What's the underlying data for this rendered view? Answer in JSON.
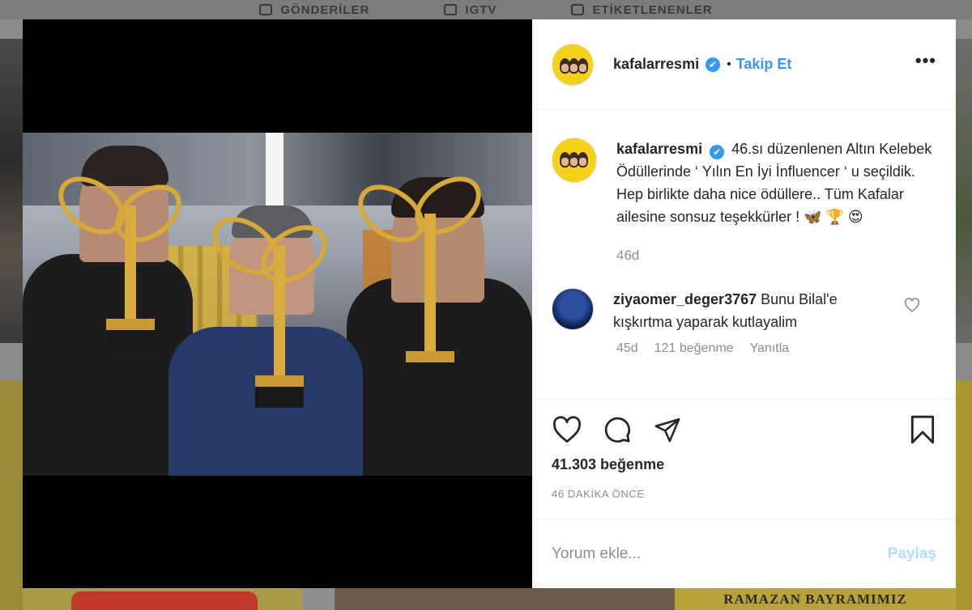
{
  "background": {
    "tabs": [
      {
        "label": "GÖNDERİLER",
        "icon": "grid-icon"
      },
      {
        "label": "IGTV",
        "icon": "igtv-icon"
      },
      {
        "label": "ETİKETLENENLER",
        "icon": "tagged-icon"
      }
    ],
    "bottom_banner": "RAMAZAN BAYRAMIMIZ"
  },
  "post": {
    "header": {
      "username": "kafalarresmi",
      "verified": "✔",
      "separator": "•",
      "follow_label": "Takip Et",
      "more_label": "•••"
    },
    "caption": {
      "username": "kafalarresmi",
      "text": "46.sı düzenlenen Altın Kelebek Ödüllerinde ‘ Yılın En İyi İnfluencer ‘ u seçildik. Hep birlikte daha nice ödüllere.. Tüm Kafalar ailesine sonsuz teşekkürler ! 🦋 🏆 😍",
      "time": "46d"
    },
    "comments": [
      {
        "username": "ziyaomer_deger3767",
        "text": "Bunu Bilal'e kışkırtma yaparak kutlayalim",
        "time": "45d",
        "likes": "121 beğenme",
        "reply_label": "Yanıtla"
      }
    ],
    "likes": "41.303 beğenme",
    "posted_ago": "46 DAKİKA ÖNCE",
    "add_comment": {
      "placeholder": "Yorum ekle...",
      "share_label": "Paylaş"
    },
    "colors": {
      "accent": "#3897f0",
      "muted": "#8e8e8e",
      "share_disabled": "#b2dffc",
      "avatar_bg": "#f5d11a"
    }
  }
}
